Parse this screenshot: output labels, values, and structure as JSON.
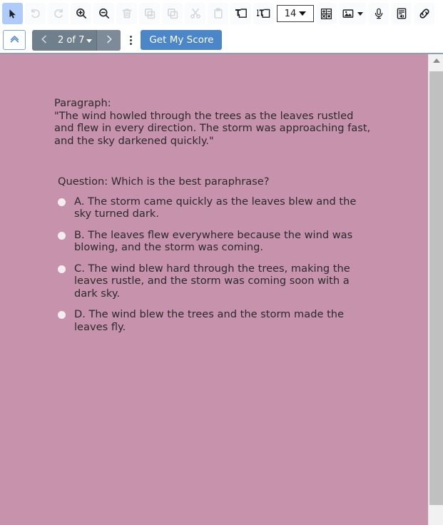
{
  "toolbar": {
    "items": [
      {
        "name": "select-tool",
        "icon": "cursor-arrow-icon",
        "state": "active"
      },
      {
        "name": "undo",
        "icon": "undo-icon",
        "state": "disabled"
      },
      {
        "name": "redo",
        "icon": "redo-icon",
        "state": "disabled"
      },
      {
        "name": "zoom-in",
        "icon": "zoom-in-icon",
        "state": "enabled"
      },
      {
        "name": "zoom-out",
        "icon": "zoom-out-icon",
        "state": "enabled"
      },
      {
        "name": "delete",
        "icon": "trash-icon",
        "state": "disabled"
      },
      {
        "name": "duplicate",
        "icon": "duplicate-icon",
        "state": "disabled"
      },
      {
        "name": "copy",
        "icon": "copy-icon",
        "state": "disabled"
      },
      {
        "name": "cut",
        "icon": "scissors-icon",
        "state": "disabled"
      },
      {
        "name": "paste",
        "icon": "clipboard-icon",
        "state": "disabled"
      },
      {
        "name": "add-text-box",
        "icon": "text-box-icon",
        "state": "enabled"
      },
      {
        "name": "add-text-line",
        "icon": "text-line-icon",
        "state": "enabled"
      }
    ],
    "font_size": "14",
    "insert_table_icon": "table-icon",
    "insert_image_icon": "image-icon",
    "record_audio_icon": "microphone-icon",
    "read_aloud_icon": "document-audio-icon",
    "insert_link_icon": "link-icon"
  },
  "navbar": {
    "collapse_icon": "double-chevron-up-icon",
    "prev_icon": "chevron-left-icon",
    "next_icon": "chevron-right-icon",
    "page_label": "2 of 7",
    "more_icon": "kebab-menu-icon",
    "score_button": "Get My Score"
  },
  "content": {
    "background_color": "#c793ac",
    "paragraph_label": "Paragraph:",
    "paragraph_text": "\"The wind howled through the trees as the leaves rustled and flew in every direction. The storm was approaching fast, and the sky darkened quickly.\"",
    "question": "Question: Which is the best paraphrase?",
    "options": [
      {
        "id": "A",
        "text": "A. The storm came quickly as the leaves blew and the sky turned dark.",
        "selected": false
      },
      {
        "id": "B",
        "text": "B. The leaves flew everywhere because the wind was blowing, and the storm was coming.",
        "selected": false
      },
      {
        "id": "C",
        "text": "C. The wind blew hard through the trees, making the leaves rustle, and the storm was coming soon with a dark sky.",
        "selected": false
      },
      {
        "id": "D",
        "text": "D. The wind blew the trees and the storm made the leaves fly.",
        "selected": false
      }
    ]
  },
  "scrollbar": {
    "up_arrow_icon": "scroll-up-arrow-icon",
    "thumb": "scrollbar-thumb"
  },
  "colors": {
    "accent_blue": "#4a86c8",
    "pager_gray": "#6f7f8c",
    "page_background": "#c793ac",
    "active_tool": "#aecbfa"
  }
}
